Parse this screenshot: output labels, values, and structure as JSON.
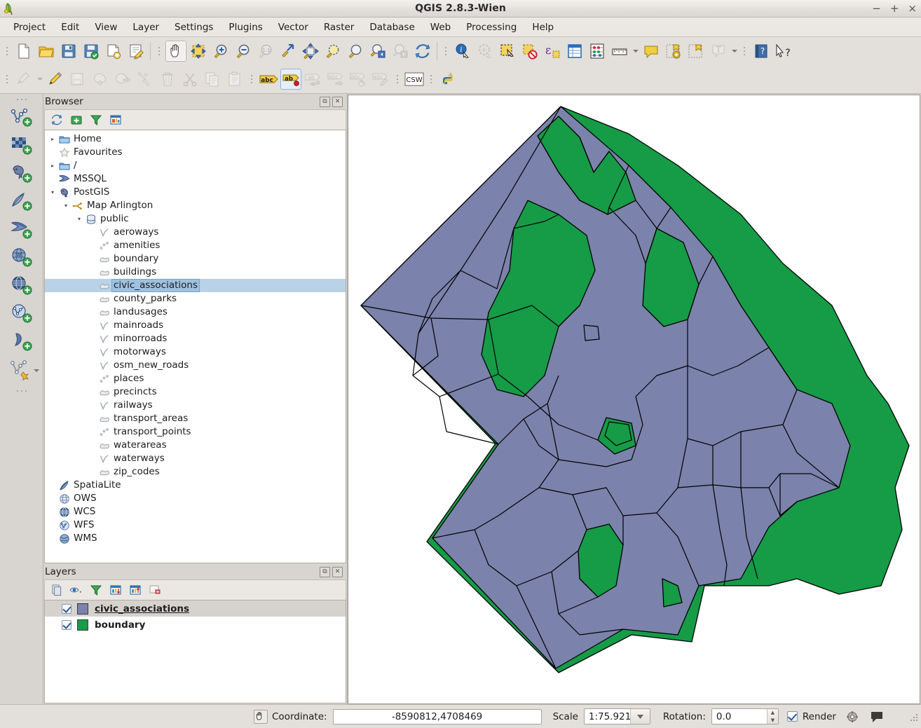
{
  "window": {
    "title": "QGIS 2.8.3-Wien",
    "app_icon": "qgis-logo-icon",
    "minimize": "−",
    "maximize": "+",
    "close": "×"
  },
  "menubar": {
    "items": [
      {
        "label": "Project"
      },
      {
        "label": "Edit"
      },
      {
        "label": "View"
      },
      {
        "label": "Layer"
      },
      {
        "label": "Settings"
      },
      {
        "label": "Plugins"
      },
      {
        "label": "Vector"
      },
      {
        "label": "Raster"
      },
      {
        "label": "Database"
      },
      {
        "label": "Web"
      },
      {
        "label": "Processing"
      },
      {
        "label": "Help"
      }
    ]
  },
  "toolbar_row1": {
    "buttons": [
      {
        "name": "new-project-icon",
        "title": "New Project"
      },
      {
        "name": "open-project-icon",
        "title": "Open Project"
      },
      {
        "name": "save-project-icon",
        "title": "Save Project"
      },
      {
        "name": "save-project-as-icon",
        "title": "Save Project As"
      },
      {
        "name": "new-print-composer-icon",
        "title": "New Print Composer"
      },
      {
        "name": "composer-manager-icon",
        "title": "Composer Manager"
      },
      {
        "name": "pan-map-icon",
        "title": "Pan Map",
        "active": true
      },
      {
        "name": "pan-to-selection-icon",
        "title": "Pan Map to Selection"
      },
      {
        "name": "zoom-in-icon",
        "title": "Zoom In"
      },
      {
        "name": "zoom-out-icon",
        "title": "Zoom Out"
      },
      {
        "name": "zoom-native-icon",
        "title": "Zoom to Native Resolution",
        "disabled": true
      },
      {
        "name": "zoom-last-arrow-icon",
        "title": "Zoom Last"
      },
      {
        "name": "zoom-full-icon",
        "title": "Zoom Full"
      },
      {
        "name": "zoom-to-selection-icon",
        "title": "Zoom to Selection"
      },
      {
        "name": "zoom-to-layer-icon",
        "title": "Zoom to Layer"
      },
      {
        "name": "zoom-previous-icon",
        "title": "Zoom Previous"
      },
      {
        "name": "zoom-next-icon",
        "title": "Zoom Next",
        "disabled": true
      },
      {
        "name": "refresh-icon",
        "title": "Refresh"
      },
      {
        "name": "identify-features-icon",
        "title": "Identify Features"
      },
      {
        "name": "run-feature-action-icon",
        "title": "Run Feature Action",
        "disabled": true
      },
      {
        "name": "select-features-icon",
        "title": "Select Features by Area"
      },
      {
        "name": "deselect-features-icon",
        "title": "Deselect Features"
      },
      {
        "name": "select-by-expression-icon",
        "title": "Select by Expression"
      },
      {
        "name": "open-attribute-table-icon",
        "title": "Open Attribute Table"
      },
      {
        "name": "field-calculator-icon",
        "title": "Open Field Calculator"
      },
      {
        "name": "measure-line-icon",
        "title": "Measure Line"
      },
      {
        "name": "map-tips-icon",
        "title": "Map Tips"
      },
      {
        "name": "new-bookmark-icon",
        "title": "New Bookmark"
      },
      {
        "name": "show-bookmarks-icon",
        "title": "Show Bookmarks"
      },
      {
        "name": "text-annotation-icon",
        "title": "Text Annotation",
        "disabled": true
      },
      {
        "name": "help-contents-icon",
        "title": "Help Contents"
      },
      {
        "name": "whats-this-icon",
        "title": "What's This?"
      }
    ]
  },
  "toolbar_row2": {
    "buttons": [
      {
        "name": "current-edits-icon",
        "title": "Current Edits",
        "disabled": true
      },
      {
        "name": "toggle-editing-icon",
        "title": "Toggle Editing"
      },
      {
        "name": "save-layer-edits-icon",
        "title": "Save Layer Edits",
        "disabled": true
      },
      {
        "name": "add-feature-icon",
        "title": "Add Feature",
        "disabled": true
      },
      {
        "name": "move-feature-icon",
        "title": "Move Feature",
        "disabled": true
      },
      {
        "name": "node-tool-icon",
        "title": "Node Tool",
        "disabled": true
      },
      {
        "name": "delete-selected-icon",
        "title": "Delete Selected",
        "disabled": true
      },
      {
        "name": "cut-features-icon",
        "title": "Cut Features",
        "disabled": true
      },
      {
        "name": "copy-features-icon",
        "title": "Copy Features",
        "disabled": true
      },
      {
        "name": "paste-features-icon",
        "title": "Paste Features",
        "disabled": true
      },
      {
        "name": "labeling-icon",
        "title": "Layer Labeling Options"
      },
      {
        "name": "pin-labels-icon",
        "title": "Pin/Unpin Labels",
        "selected": true
      },
      {
        "name": "show-hide-labels-icon",
        "title": "Show/Hide Labels",
        "disabled": true
      },
      {
        "name": "move-label-icon",
        "title": "Move Label",
        "disabled": true
      },
      {
        "name": "rotate-label-icon",
        "title": "Rotate Label",
        "disabled": true
      },
      {
        "name": "change-label-icon",
        "title": "Change Label",
        "disabled": true
      },
      {
        "name": "metasearch-csw-icon",
        "title": "MetaSearch",
        "label": "CSW"
      },
      {
        "name": "python-console-icon",
        "title": "Python Console"
      }
    ]
  },
  "left_toolbar": {
    "buttons": [
      {
        "name": "add-vector-layer-icon",
        "title": "Add Vector Layer"
      },
      {
        "name": "add-raster-layer-icon",
        "title": "Add Raster Layer"
      },
      {
        "name": "add-postgis-layer-icon",
        "title": "Add PostGIS Layers"
      },
      {
        "name": "add-spatialite-layer-icon",
        "title": "Add SpatiaLite Layer"
      },
      {
        "name": "add-mssql-layer-icon",
        "title": "Add MSSQL Spatial Layer"
      },
      {
        "name": "add-wms-layer-icon",
        "title": "Add WMS/WMTS Layer"
      },
      {
        "name": "add-wcs-layer-icon",
        "title": "Add WCS Layer"
      },
      {
        "name": "add-wfs-layer-icon",
        "title": "Add WFS Layer"
      },
      {
        "name": "add-delimited-text-layer-icon",
        "title": "Add Delimited Text Layer"
      },
      {
        "name": "new-shapefile-layer-icon",
        "title": "New Shapefile Layer"
      }
    ]
  },
  "browser_panel": {
    "title": "Browser",
    "float_btn": "⧉",
    "close_btn": "✕",
    "tools": [
      {
        "name": "refresh-browser-icon",
        "title": "Refresh"
      },
      {
        "name": "add-selected-layers-icon",
        "title": "Add Selected Layers"
      },
      {
        "name": "filter-browser-icon",
        "title": "Filter Browser"
      },
      {
        "name": "collapse-all-icon",
        "title": "Collapse All"
      }
    ],
    "tree": [
      {
        "label": "Home",
        "icon": "folder-icon",
        "indent": 0,
        "arrow": "collapsed"
      },
      {
        "label": "Favourites",
        "icon": "star-icon",
        "indent": 0,
        "arrow": "none"
      },
      {
        "label": "/",
        "icon": "folder-icon",
        "indent": 0,
        "arrow": "collapsed"
      },
      {
        "label": "MSSQL",
        "icon": "mssql-icon",
        "indent": 0,
        "arrow": "none"
      },
      {
        "label": "PostGIS",
        "icon": "postgis-elephant-icon",
        "indent": 0,
        "arrow": "expanded"
      },
      {
        "label": "Map Arlington",
        "icon": "db-connection-icon",
        "indent": 1,
        "arrow": "expanded"
      },
      {
        "label": "public",
        "icon": "schema-icon",
        "indent": 2,
        "arrow": "expanded"
      },
      {
        "label": "aeroways",
        "icon": "line-layer-icon",
        "indent": 3,
        "arrow": "none"
      },
      {
        "label": "amenities",
        "icon": "point-layer-icon",
        "indent": 3,
        "arrow": "none"
      },
      {
        "label": "boundary",
        "icon": "polygon-layer-icon",
        "indent": 3,
        "arrow": "none"
      },
      {
        "label": "buildings",
        "icon": "polygon-layer-icon",
        "indent": 3,
        "arrow": "none"
      },
      {
        "label": "civic_associations",
        "icon": "polygon-layer-icon",
        "indent": 3,
        "arrow": "none",
        "selected": true
      },
      {
        "label": "county_parks",
        "icon": "polygon-layer-icon",
        "indent": 3,
        "arrow": "none"
      },
      {
        "label": "landusages",
        "icon": "polygon-layer-icon",
        "indent": 3,
        "arrow": "none"
      },
      {
        "label": "mainroads",
        "icon": "line-layer-icon",
        "indent": 3,
        "arrow": "none"
      },
      {
        "label": "minorroads",
        "icon": "line-layer-icon",
        "indent": 3,
        "arrow": "none"
      },
      {
        "label": "motorways",
        "icon": "line-layer-icon",
        "indent": 3,
        "arrow": "none"
      },
      {
        "label": "osm_new_roads",
        "icon": "line-layer-icon",
        "indent": 3,
        "arrow": "none"
      },
      {
        "label": "places",
        "icon": "point-layer-icon",
        "indent": 3,
        "arrow": "none"
      },
      {
        "label": "precincts",
        "icon": "polygon-layer-icon",
        "indent": 3,
        "arrow": "none"
      },
      {
        "label": "railways",
        "icon": "line-layer-icon",
        "indent": 3,
        "arrow": "none"
      },
      {
        "label": "transport_areas",
        "icon": "polygon-layer-icon",
        "indent": 3,
        "arrow": "none"
      },
      {
        "label": "transport_points",
        "icon": "point-layer-icon",
        "indent": 3,
        "arrow": "none"
      },
      {
        "label": "waterareas",
        "icon": "polygon-layer-icon",
        "indent": 3,
        "arrow": "none"
      },
      {
        "label": "waterways",
        "icon": "line-layer-icon",
        "indent": 3,
        "arrow": "none"
      },
      {
        "label": "zip_codes",
        "icon": "polygon-layer-icon",
        "indent": 3,
        "arrow": "none"
      },
      {
        "label": "SpatiaLite",
        "icon": "spatialite-feather-icon",
        "indent": 0,
        "arrow": "none"
      },
      {
        "label": "OWS",
        "icon": "ows-globe-icon",
        "indent": 0,
        "arrow": "none"
      },
      {
        "label": "WCS",
        "icon": "wcs-globe-icon",
        "indent": 0,
        "arrow": "none"
      },
      {
        "label": "WFS",
        "icon": "wfs-globe-icon",
        "indent": 0,
        "arrow": "none"
      },
      {
        "label": "WMS",
        "icon": "wms-globe-icon",
        "indent": 0,
        "arrow": "none"
      }
    ]
  },
  "layers_panel": {
    "title": "Layers",
    "float_btn": "⧉",
    "close_btn": "✕",
    "tools": [
      {
        "name": "add-group-icon",
        "title": "Add Group"
      },
      {
        "name": "manage-layer-visibility-icon",
        "title": "Manage Layer Visibility"
      },
      {
        "name": "filter-legend-icon",
        "title": "Filter Legend by Map Content"
      },
      {
        "name": "expand-all-icon",
        "title": "Expand All"
      },
      {
        "name": "collapse-all-layers-icon",
        "title": "Collapse All"
      },
      {
        "name": "remove-layer-icon",
        "title": "Remove Layer/Group"
      }
    ],
    "layers": [
      {
        "name": "civic_associations",
        "color": "#7b82ab",
        "checked": true,
        "current": true
      },
      {
        "name": "boundary",
        "color": "#169b47",
        "checked": true,
        "current": false
      }
    ]
  },
  "statusbar": {
    "coordinate_icon": "coordinate-toggle-icon",
    "coordinate_label": "Coordinate:",
    "coordinate_value": "-8590812,4708469",
    "scale_label": "Scale",
    "scale_value": "1:75.921",
    "rotation_label": "Rotation:",
    "rotation_value": "0.0",
    "render_label": "Render",
    "render_checked": true,
    "crs_icon": "crs-status-icon",
    "messages_icon": "messages-log-icon"
  },
  "map": {
    "layers": {
      "boundary_fill": "#169b47",
      "civic_fill": "#7b82ab",
      "outline": "#000000",
      "background": "#ffffff"
    },
    "name": "arlington-county-civic-associations-map"
  }
}
